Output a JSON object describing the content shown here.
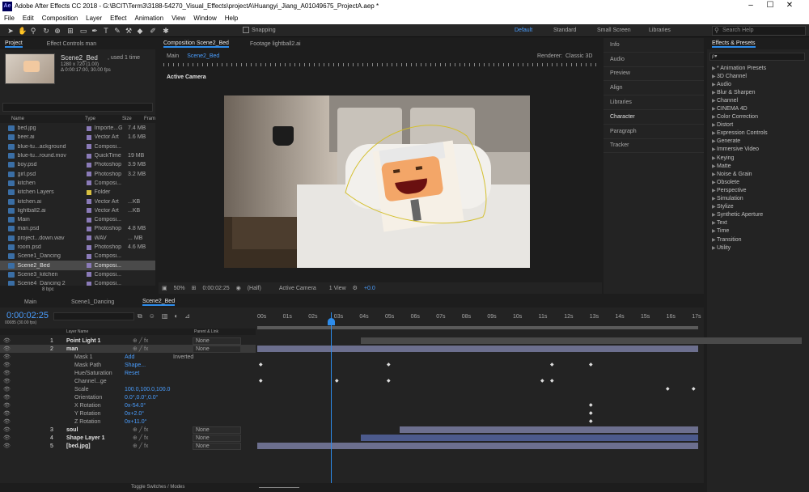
{
  "window": {
    "title": "Adobe After Effects CC 2018 - G:\\BCIT\\Term3\\3188-54270_Visual_Effects\\projectA\\Huangyi_Jiang_A01049675_ProjectA.aep *",
    "logo": "Ae"
  },
  "menu": [
    "File",
    "Edit",
    "Composition",
    "Layer",
    "Effect",
    "Animation",
    "View",
    "Window",
    "Help"
  ],
  "toolbar": {
    "snapping": "Snapping",
    "workspaces": [
      "Default",
      "Standard",
      "Small Screen",
      "Libraries"
    ],
    "active_workspace": "Default",
    "search_placeholder": "Search Help"
  },
  "project_panel": {
    "tabs": [
      "Project",
      "Effect Controls man"
    ],
    "selected_item": {
      "name": "Scene2_Bed",
      "used": ", used 1 time",
      "dims": "1280 x 720 (1.00)",
      "duration": "Δ 0:00:17:00, 30.00 fps"
    },
    "columns": [
      "Name",
      "Type",
      "Size",
      "Fram"
    ],
    "items": [
      {
        "name": "bed.jpg",
        "type": "Importe...G",
        "size": "7.4 MB",
        "lab": "#8a7ab8"
      },
      {
        "name": "beer.ai",
        "type": "Vector Art",
        "size": "1.6 MB",
        "lab": "#8a7ab8"
      },
      {
        "name": "blue-tu...ackground",
        "type": "Composi...",
        "size": "",
        "lab": "#8a7ab8"
      },
      {
        "name": "blue-tu...round.mov",
        "type": "QuickTime",
        "size": "19 MB",
        "lab": "#8a7ab8"
      },
      {
        "name": "boy.psd",
        "type": "Photoshop",
        "size": "3.9 MB",
        "lab": "#8a7ab8"
      },
      {
        "name": "girl.psd",
        "type": "Photoshop",
        "size": "3.2 MB",
        "lab": "#8a7ab8"
      },
      {
        "name": "kitchen",
        "type": "Composi...",
        "size": "",
        "lab": "#8a7ab8"
      },
      {
        "name": "kitchen Layers",
        "type": "Folder",
        "size": "",
        "lab": "#d8c040"
      },
      {
        "name": "kitchen.ai",
        "type": "Vector Art",
        "size": "...KB",
        "lab": "#8a7ab8"
      },
      {
        "name": "lightball2.ai",
        "type": "Vector Art",
        "size": "...KB",
        "lab": "#8a7ab8"
      },
      {
        "name": "Main",
        "type": "Composi...",
        "size": "",
        "lab": "#8a7ab8"
      },
      {
        "name": "man.psd",
        "type": "Photoshop",
        "size": "4.8 MB",
        "lab": "#8a7ab8"
      },
      {
        "name": "project...down.wav",
        "type": "WAV",
        "size": "... MB",
        "lab": "#8a7ab8"
      },
      {
        "name": "room.psd",
        "type": "Photoshop",
        "size": "4.6 MB",
        "lab": "#8a7ab8"
      },
      {
        "name": "Scene1_Dancing",
        "type": "Composi...",
        "size": "",
        "lab": "#8a7ab8"
      },
      {
        "name": "Scene2_Bed",
        "type": "Composi...",
        "size": "",
        "lab": "#8a7ab8"
      },
      {
        "name": "Scene3_kitchen",
        "type": "Composi...",
        "size": "",
        "lab": "#8a7ab8"
      },
      {
        "name": "Scene4_Dancing 2",
        "type": "Composi...",
        "size": "",
        "lab": "#8a7ab8"
      }
    ],
    "bpc": "8 bpc"
  },
  "comp_panel": {
    "tabs": [
      "Composition Scene2_Bed",
      "Footage lightball2.ai"
    ],
    "breadcrumb": [
      "Main",
      "Scene2_Bed"
    ],
    "renderer_label": "Renderer:",
    "renderer": "Classic 3D",
    "active_camera": "Active Camera",
    "zoom": "50%",
    "timecode": "0:00:02:25",
    "resolution": "(Half)",
    "view": "Active Camera",
    "views": "1 View",
    "exposure": "+0.0"
  },
  "right_panels": [
    "Info",
    "Audio",
    "Preview",
    "Align",
    "Libraries",
    "Character",
    "Paragraph",
    "Tracker"
  ],
  "effects_presets": {
    "title": "Effects & Presets",
    "search": "ρ▾",
    "items": [
      "* Animation Presets",
      "3D Channel",
      "Audio",
      "Blur & Sharpen",
      "Channel",
      "CINEMA 4D",
      "Color Correction",
      "Distort",
      "Expression Controls",
      "Generate",
      "Immersive Video",
      "Keying",
      "Matte",
      "Noise & Grain",
      "Obsolete",
      "Perspective",
      "Simulation",
      "Stylize",
      "Synthetic Aperture",
      "Text",
      "Time",
      "Transition",
      "Utility"
    ]
  },
  "timeline": {
    "tabs": [
      "Main",
      "Scene1_Dancing",
      "Scene2_Bed"
    ],
    "timecode": "0:00:02:25",
    "frame_info": "00085 (30.00 fps)",
    "col_layer": "Layer Name",
    "col_parent": "Parent & Link",
    "ruler": [
      "00s",
      "01s",
      "02s",
      "03s",
      "04s",
      "05s",
      "06s",
      "07s",
      "08s",
      "09s",
      "10s",
      "11s",
      "12s",
      "13s",
      "14s",
      "15s",
      "16s",
      "17s"
    ],
    "rows": [
      {
        "num": "1",
        "name": "Point Light 1",
        "parent": "None",
        "bold": true
      },
      {
        "num": "2",
        "name": "man",
        "parent": "None",
        "bold": true
      },
      {
        "num": "",
        "name": "Mask 1",
        "value": "Add",
        "extra": "Inverted"
      },
      {
        "num": "",
        "name": "Mask Path",
        "value": "Shape..."
      },
      {
        "num": "",
        "name": "Hue/Saturation",
        "value": "Reset"
      },
      {
        "num": "",
        "name": "Channel...ge",
        "value": ""
      },
      {
        "num": "",
        "name": "Scale",
        "value": "100.0,100.0,100.0"
      },
      {
        "num": "",
        "name": "Orientation",
        "value": "0.0°,0.0°,0.0°"
      },
      {
        "num": "",
        "name": "X Rotation",
        "value": "0x-54.0°"
      },
      {
        "num": "",
        "name": "Y Rotation",
        "value": "0x+2.0°"
      },
      {
        "num": "",
        "name": "Z Rotation",
        "value": "0x+11.0°"
      },
      {
        "num": "3",
        "name": "soul",
        "parent": "None",
        "bold": true
      },
      {
        "num": "4",
        "name": "Shape Layer 1",
        "parent": "None",
        "bold": true
      },
      {
        "num": "5",
        "name": "[bed.jpg]",
        "parent": "None",
        "bold": true
      }
    ],
    "footer": "Toggle Switches / Modes"
  }
}
